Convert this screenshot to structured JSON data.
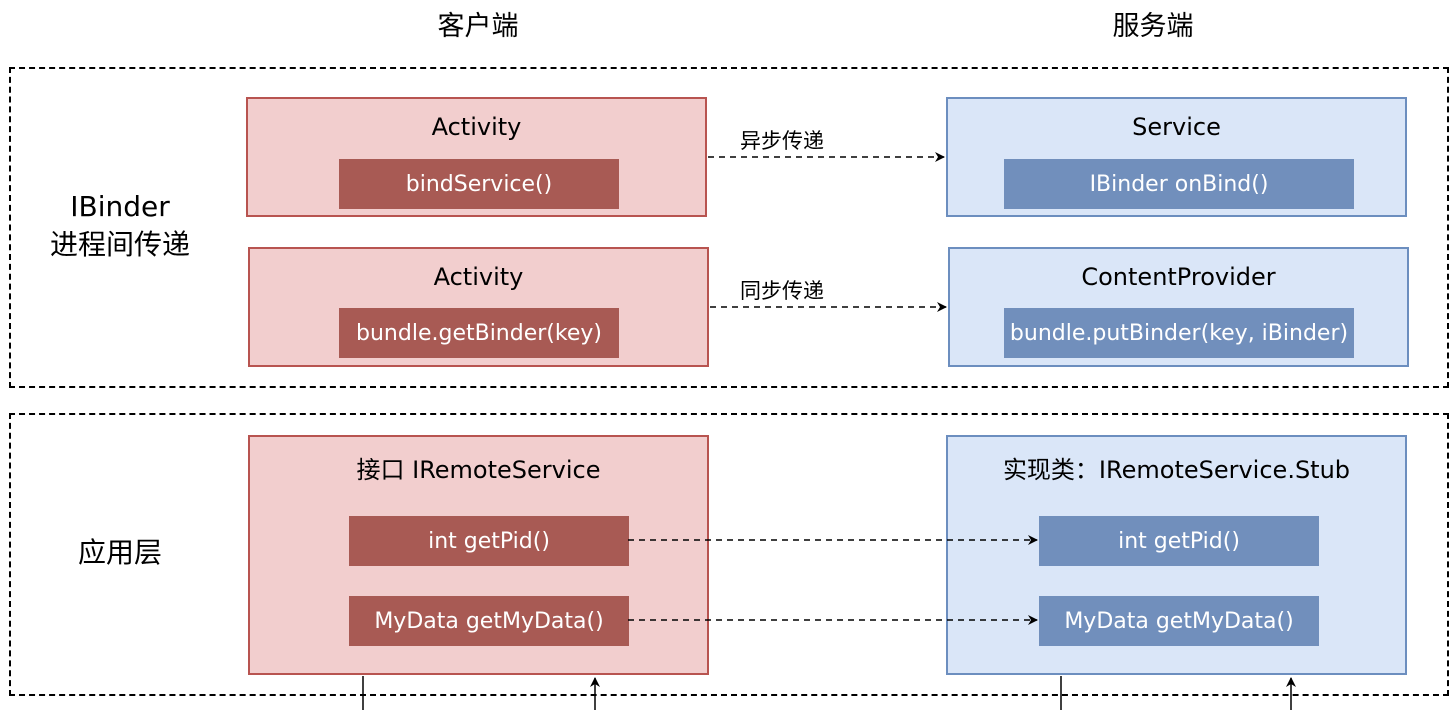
{
  "columns": {
    "client": "客户端",
    "server": "服务端"
  },
  "sections": {
    "ipc": {
      "label_line1": "IBinder",
      "label_line2": "进程间传递",
      "rows": [
        {
          "client_title": "Activity",
          "client_method": "bindService()",
          "edge_label": "异步传递",
          "server_title": "Service",
          "server_method": "IBinder onBind()"
        },
        {
          "client_title": "Activity",
          "client_method": "bundle.getBinder(key)",
          "edge_label": "同步传递",
          "server_title": "ContentProvider",
          "server_method": "bundle.putBinder(key, iBinder)"
        }
      ]
    },
    "app": {
      "label": "应用层",
      "client_title": "接口 IRemoteService",
      "server_title": "实现类：IRemoteService.Stub",
      "client_methods": [
        "int getPid()",
        "MyData getMyData()"
      ],
      "server_methods": [
        "int getPid()",
        "MyData getMyData()"
      ]
    }
  },
  "colors": {
    "client_fill": "#f2cece",
    "client_stroke": "#b85450",
    "client_chip": "#a85a54",
    "server_fill": "#dae6f8",
    "server_stroke": "#6c8ebf",
    "server_chip": "#718fbc"
  }
}
